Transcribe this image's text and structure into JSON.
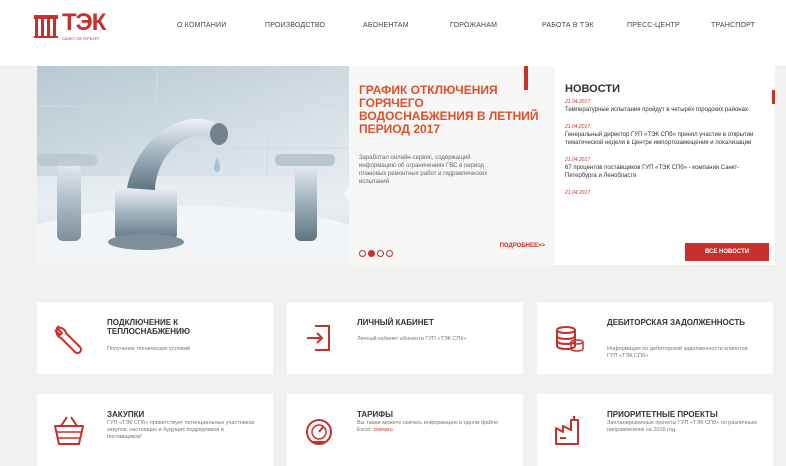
{
  "logo": {
    "text": "ТЭК",
    "subtitle": "САНКТ-ПЕТЕРБУРГ"
  },
  "nav": [
    "О КОМПАНИИ",
    "ПРОИЗВОДСТВО",
    "АБОНЕНТАМ",
    "ГОРОЖАНАМ",
    "РАБОТА В ТЭК",
    "ПРЕСС-ЦЕНТР",
    "ТРАНСПОРТ"
  ],
  "hero": {
    "title": "ГРАФИК ОТКЛЮЧЕНИЯ ГОРЯЧЕГО ВОДОСНАБЖЕНИЯ В ЛЕТНИЙ ПЕРИОД 2017",
    "description": "Заработал онлайн-сервис, содержащий информацию об ограничениях ГВС в период плановых ремонтных работ и гидравлических испытаний",
    "more": "ПОДРОБНЕЕ>>",
    "slide_index": 2,
    "slide_count": 4
  },
  "news": {
    "title": "НОВОСТИ",
    "items": [
      {
        "date": "21.04.2017",
        "text": "Температурные испытания пройдут в четырёх городских районах"
      },
      {
        "date": "21.04.2017",
        "text": "Генеральный директор ГУП «ТЭК СПб» принял участие в открытии тематической недели в Центре импортозамещения и локализации"
      },
      {
        "date": "21.04.2017",
        "text": "67 процентов поставщиков ГУП «ТЭК СПб» - компании Санкт-Петербурга и Ленобласти"
      },
      {
        "date": "21.04.2017",
        "text": ""
      }
    ],
    "all_button": "ВСЕ НОВОСТИ"
  },
  "tiles": [
    {
      "title": "ПОДКЛЮЧЕНИЕ К ТЕПЛОСНАБЖЕНИЮ",
      "desc": "Получение технических условий",
      "link": ""
    },
    {
      "title": "ЛИЧНЫЙ КАБИНЕТ",
      "desc": "Личный кабинет абонента ГУП «ТЭК СПб»",
      "link": ""
    },
    {
      "title": "ДЕБИТОРСКАЯ ЗАДОЛЖЕННОСТЬ",
      "desc": "Информация по дебиторской задолженности клиентов ГУП «ТЭК СПб»",
      "link": ""
    },
    {
      "title": "ЗАКУПКИ",
      "desc": "ГУП «ТЭК СПб» приветствует потенциальных участников закупок, настоящих и будущих подрядчиков и поставщиков!",
      "link": ""
    },
    {
      "title": "ТАРИФЫ",
      "desc": "Вы также можете скачать информацию в одном файле Excel:",
      "link": "скачать"
    },
    {
      "title": "ПРИОРИТЕТНЫЕ ПРОЕКТЫ",
      "desc": "Запланированные проекты ГУП «ТЭК СПб» по различным направлениям на 2016 год",
      "link": ""
    }
  ],
  "colors": {
    "accent": "#c9302c",
    "hero_title": "#e14e2a"
  }
}
